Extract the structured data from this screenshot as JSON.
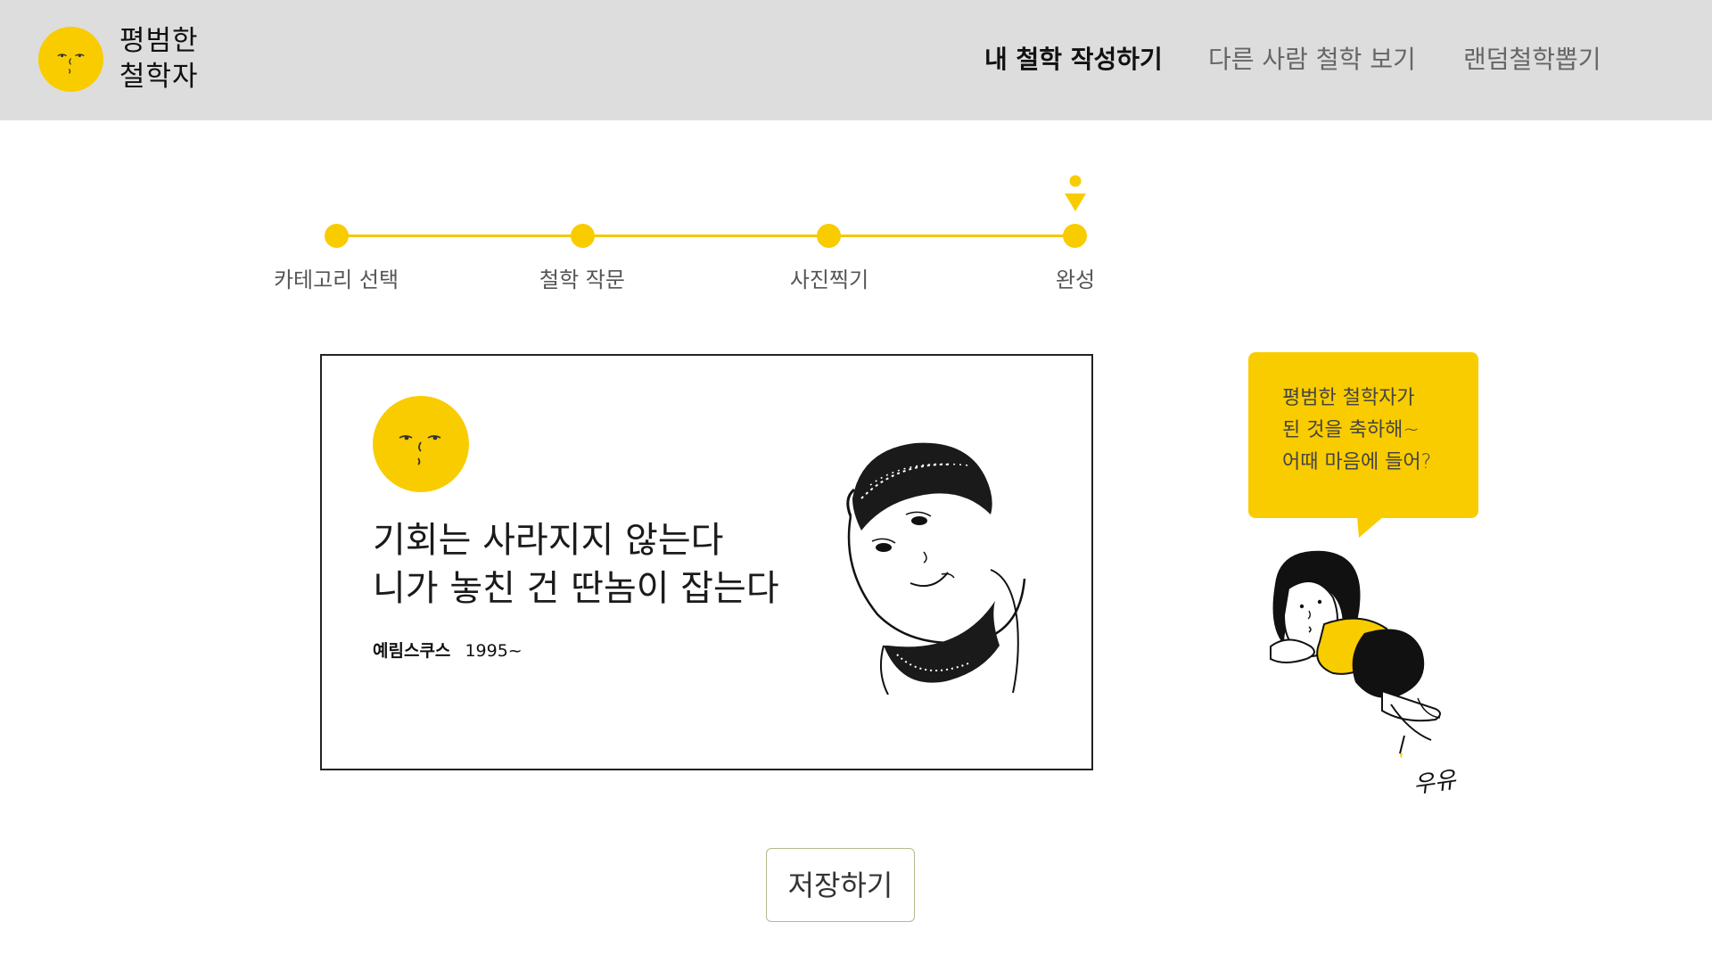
{
  "header": {
    "logo_line1": "평범한",
    "logo_line2": "철학자",
    "nav": [
      {
        "label": "내 철학 작성하기",
        "active": true
      },
      {
        "label": "다른 사람 철학 보기",
        "active": false
      },
      {
        "label": "랜덤철학뽑기",
        "active": false
      }
    ]
  },
  "stepper": {
    "steps": [
      {
        "label": "카테고리 선택"
      },
      {
        "label": "철학 작문"
      },
      {
        "label": "사진찍기"
      },
      {
        "label": "완성"
      }
    ],
    "current_step": 4
  },
  "card": {
    "quote_line1": "기회는 사라지지 않는다",
    "quote_line2": "니가 놓친 건 딴놈이 잡는다",
    "author_name": "예림스쿠스",
    "author_year": "1995~"
  },
  "bubble": {
    "line1": "평범한 철학자가",
    "line2": "된 것을 축하해~",
    "line3": "어때 마음에 들어?"
  },
  "signature": "우유",
  "save_button": {
    "label": "저장하기"
  },
  "colors": {
    "accent": "#f9cc00",
    "header_bg": "#dddddd",
    "button_border": "#b7b98e"
  },
  "icons": {
    "logo": "yellow-moon-face-icon",
    "step_marker": "person-marker-icon"
  }
}
